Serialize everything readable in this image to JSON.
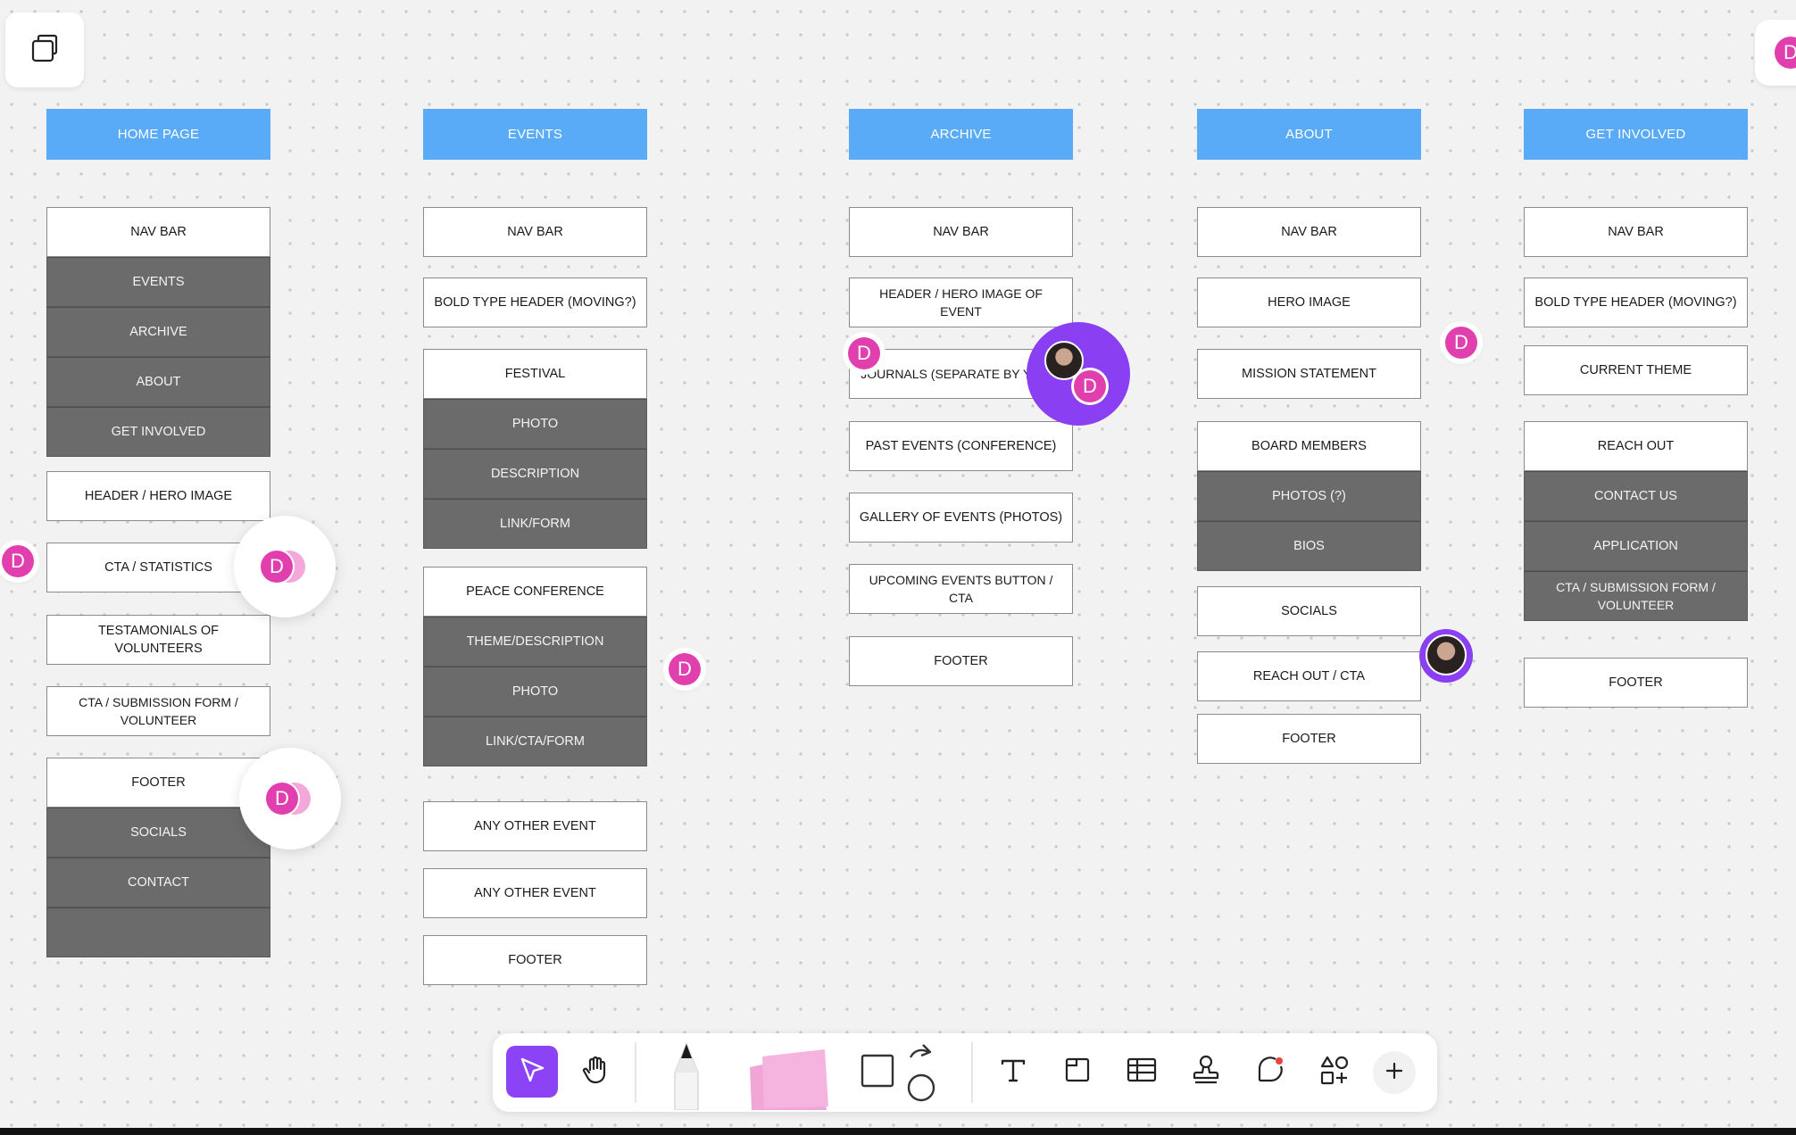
{
  "columns": [
    {
      "id": "home",
      "title": "HOME PAGE",
      "blocks": [
        {
          "id": "nav",
          "items": [
            {
              "label": "NAV BAR",
              "style": "white"
            },
            {
              "label": "EVENTS",
              "style": "dark"
            },
            {
              "label": "ARCHIVE",
              "style": "dark"
            },
            {
              "label": "ABOUT",
              "style": "dark"
            },
            {
              "label": "GET INVOLVED",
              "style": "dark"
            }
          ]
        },
        {
          "id": "hero",
          "items": [
            {
              "label": "HEADER / HERO IMAGE",
              "style": "white"
            }
          ]
        },
        {
          "id": "cta-stats",
          "items": [
            {
              "label": "CTA / STATISTICS",
              "style": "white"
            }
          ]
        },
        {
          "id": "testimonials",
          "items": [
            {
              "label": "TESTAMONIALS OF VOLUNTEERS",
              "style": "white"
            }
          ]
        },
        {
          "id": "cta-form",
          "items": [
            {
              "label": "CTA / SUBMISSION FORM / VOLUNTEER",
              "style": "white"
            }
          ]
        },
        {
          "id": "footer",
          "items": [
            {
              "label": "FOOTER",
              "style": "white"
            },
            {
              "label": "SOCIALS",
              "style": "dark"
            },
            {
              "label": "CONTACT",
              "style": "dark"
            },
            {
              "label": "",
              "style": "dark"
            }
          ]
        }
      ]
    },
    {
      "id": "events",
      "title": "EVENTS",
      "blocks": [
        {
          "id": "nav",
          "items": [
            {
              "label": "NAV BAR",
              "style": "white"
            }
          ]
        },
        {
          "id": "header",
          "items": [
            {
              "label": "BOLD TYPE HEADER (MOVING?)",
              "style": "white"
            }
          ]
        },
        {
          "id": "festival",
          "items": [
            {
              "label": "FESTIVAL",
              "style": "white"
            },
            {
              "label": "PHOTO",
              "style": "dark"
            },
            {
              "label": "DESCRIPTION",
              "style": "dark"
            },
            {
              "label": "LINK/FORM",
              "style": "dark"
            }
          ]
        },
        {
          "id": "peace",
          "items": [
            {
              "label": "PEACE CONFERENCE",
              "style": "white"
            },
            {
              "label": "THEME/DESCRIPTION",
              "style": "dark"
            },
            {
              "label": "PHOTO",
              "style": "dark"
            },
            {
              "label": "LINK/CTA/FORM",
              "style": "dark"
            }
          ]
        },
        {
          "id": "other1",
          "items": [
            {
              "label": "ANY OTHER EVENT",
              "style": "white"
            }
          ]
        },
        {
          "id": "other2",
          "items": [
            {
              "label": "ANY OTHER EVENT",
              "style": "white"
            }
          ]
        },
        {
          "id": "footer",
          "items": [
            {
              "label": "FOOTER",
              "style": "white"
            }
          ]
        }
      ]
    },
    {
      "id": "archive",
      "title": "ARCHIVE",
      "blocks": [
        {
          "id": "nav",
          "items": [
            {
              "label": "NAV BAR",
              "style": "white"
            }
          ]
        },
        {
          "id": "header",
          "items": [
            {
              "label": "HEADER / HERO IMAGE OF EVENT",
              "style": "white"
            }
          ]
        },
        {
          "id": "journals",
          "items": [
            {
              "label": "JOURNALS (SEPARATE BY YEAR)",
              "style": "white"
            }
          ]
        },
        {
          "id": "past",
          "items": [
            {
              "label": "PAST EVENTS (CONFERENCE)",
              "style": "white"
            }
          ]
        },
        {
          "id": "gallery",
          "items": [
            {
              "label": "GALLERY OF EVENTS (PHOTOS)",
              "style": "white"
            }
          ]
        },
        {
          "id": "upcoming",
          "items": [
            {
              "label": "UPCOMING EVENTS BUTTON / CTA",
              "style": "white"
            }
          ]
        },
        {
          "id": "footer",
          "items": [
            {
              "label": "FOOTER",
              "style": "white"
            }
          ]
        }
      ]
    },
    {
      "id": "about",
      "title": "ABOUT",
      "blocks": [
        {
          "id": "nav",
          "items": [
            {
              "label": "NAV BAR",
              "style": "white"
            }
          ]
        },
        {
          "id": "hero",
          "items": [
            {
              "label": "HERO IMAGE",
              "style": "white"
            }
          ]
        },
        {
          "id": "mission",
          "items": [
            {
              "label": "MISSION STATEMENT",
              "style": "white"
            }
          ]
        },
        {
          "id": "board",
          "items": [
            {
              "label": "BOARD MEMBERS",
              "style": "white"
            },
            {
              "label": "PHOTOS (?)",
              "style": "dark"
            },
            {
              "label": "BIOS",
              "style": "dark"
            }
          ]
        },
        {
          "id": "socials",
          "items": [
            {
              "label": "SOCIALS",
              "style": "white"
            }
          ]
        },
        {
          "id": "reach",
          "items": [
            {
              "label": "REACH OUT / CTA",
              "style": "white"
            }
          ]
        },
        {
          "id": "footer",
          "items": [
            {
              "label": "FOOTER",
              "style": "white"
            }
          ]
        }
      ]
    },
    {
      "id": "get-involved",
      "title": "GET INVOLVED",
      "blocks": [
        {
          "id": "nav",
          "items": [
            {
              "label": "NAV BAR",
              "style": "white"
            }
          ]
        },
        {
          "id": "header",
          "items": [
            {
              "label": "BOLD TYPE HEADER (MOVING?)",
              "style": "white"
            }
          ]
        },
        {
          "id": "theme",
          "items": [
            {
              "label": "CURRENT THEME",
              "style": "white"
            }
          ]
        },
        {
          "id": "reach",
          "items": [
            {
              "label": "REACH OUT",
              "style": "white"
            },
            {
              "label": "CONTACT US",
              "style": "dark"
            },
            {
              "label": "APPLICATION",
              "style": "dark"
            },
            {
              "label": "CTA / SUBMISSION FORM / VOLUNTEER",
              "style": "dark"
            }
          ]
        },
        {
          "id": "footer",
          "items": [
            {
              "label": "FOOTER",
              "style": "white"
            }
          ]
        }
      ]
    }
  ],
  "avatar_initial": "D",
  "toolbar": {
    "tools": [
      "pointer-icon",
      "hand-icon",
      "pen-icon",
      "sticky-note-icon",
      "shape-icon",
      "text-icon",
      "section-icon",
      "table-icon",
      "stamp-icon",
      "comment-icon",
      "widgets-icon",
      "plus-icon"
    ],
    "active": "pointer-icon"
  },
  "colors": {
    "header_blue": "#5aabf7",
    "dark_box": "#6b6b6b",
    "avatar_pink": "#e23fae",
    "accent_purple": "#8b43f5"
  }
}
